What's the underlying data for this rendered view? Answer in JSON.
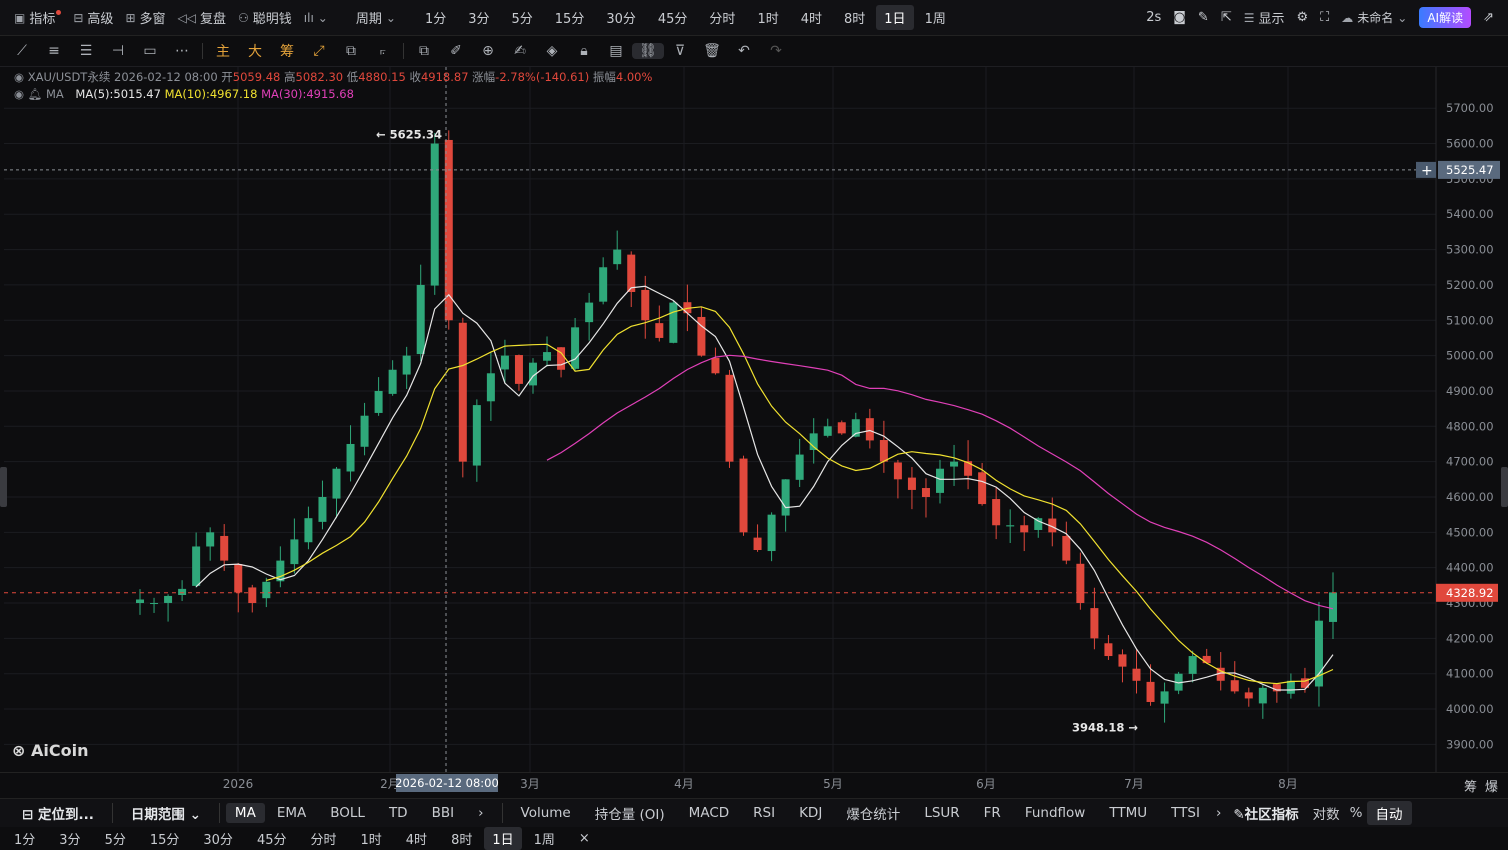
{
  "topbar": {
    "indicator": "指标",
    "advanced": "高级",
    "multiwindow": "多窗",
    "replay": "复盘",
    "smart_money": "聪明钱",
    "period_label": "周期",
    "periods": [
      "1分",
      "3分",
      "5分",
      "15分",
      "30分",
      "45分",
      "分时",
      "1时",
      "4时",
      "8时",
      "1日",
      "1周"
    ],
    "active_period": "1日",
    "refresh": "2s",
    "display": "显示",
    "layout_name": "未命名",
    "ai": "AI解读"
  },
  "legend": {
    "symbol": "XAU/USDT永续",
    "datetime": "2026-02-12 08:00",
    "open_label": "开",
    "open": "5059.48",
    "high_label": "高",
    "high": "5082.30",
    "low_label": "低",
    "low": "4880.15",
    "close_label": "收",
    "close": "4918.87",
    "change_label": "涨幅",
    "change": "-2.78%(-140.61)",
    "amp_label": "振幅",
    "amp": "4.00%",
    "ma_label": "MA",
    "ma5": "MA(5):5015.47",
    "ma10": "MA(10):4967.18",
    "ma30": "MA(30):4915.68"
  },
  "chart_data": {
    "type": "candlestick",
    "symbol": "XAU/USDT永续",
    "interval": "1日",
    "ylim": [
      3870,
      5760
    ],
    "yticks": [
      5700,
      5600,
      5500,
      5400,
      5300,
      5200,
      5100,
      5000,
      4900,
      4800,
      4700,
      4600,
      4500,
      4400,
      4300,
      4200,
      4100,
      4000,
      3900
    ],
    "y_tick_labels": [
      "5700.00",
      "5600.00",
      "5500.00",
      "5400.00",
      "5300.00",
      "5200.00",
      "5100.00",
      "5000.00",
      "4900.00",
      "4800.00",
      "4700.00",
      "4600.00",
      "4500.00",
      "4400.00",
      "4300.00",
      "4200.00",
      "4100.00",
      "4000.00",
      "3900.00"
    ],
    "x_labels": [
      "2026",
      "2月",
      "3月",
      "4月",
      "5月",
      "6月",
      "7月",
      "8月"
    ],
    "crosshair_price": "5525.47",
    "crosshair_date": "2026-02-12 08:00",
    "last_price": "4328.92",
    "max_label": "5625.34",
    "min_label": "3948.18",
    "ma_series": [
      {
        "name": "MA(5)",
        "color": "#e6e6e6"
      },
      {
        "name": "MA(10)",
        "color": "#f0e130"
      },
      {
        "name": "MA(30)",
        "color": "#e040b8"
      }
    ],
    "close_path": [
      4310,
      4300,
      4320,
      4340,
      4460,
      4500,
      4420,
      4330,
      4300,
      4360,
      4420,
      4480,
      4540,
      4600,
      4680,
      4750,
      4830,
      4900,
      4960,
      5000,
      5200,
      5600,
      5100,
      4700,
      4860,
      4950,
      5000,
      4920,
      4980,
      5010,
      4960,
      5080,
      5150,
      5250,
      5300,
      5180,
      5100,
      5050,
      5150,
      5120,
      5000,
      4950,
      4700,
      4500,
      4450,
      4550,
      4650,
      4720,
      4780,
      4800,
      4780,
      4820,
      4760,
      4700,
      4650,
      4620,
      4600,
      4680,
      4700,
      4660,
      4580,
      4520,
      4520,
      4500,
      4540,
      4500,
      4420,
      4300,
      4200,
      4150,
      4120,
      4080,
      4020,
      4050,
      4100,
      4150,
      4130,
      4080,
      4050,
      4030,
      4060,
      4050,
      4080,
      4060,
      4250,
      4330
    ]
  },
  "bottombar": {
    "locate": "定位到...",
    "range": "日期范围",
    "main_indicators": [
      "MA",
      "EMA",
      "BOLL",
      "TD",
      "BBI"
    ],
    "active_main": "MA",
    "sub_indicators": [
      "Volume",
      "持仓量 (OI)",
      "MACD",
      "RSI",
      "KDJ",
      "爆仓统计",
      "LSUR",
      "FR",
      "Fundflow",
      "TTMU",
      "TTSI"
    ],
    "community": "社区指标",
    "log": "对数",
    "percent": "%",
    "auto": "自动"
  },
  "bottombar2": {
    "periods": [
      "1分",
      "3分",
      "5分",
      "15分",
      "30分",
      "45分",
      "分时",
      "1时",
      "4时",
      "8时",
      "1日",
      "1周"
    ],
    "active": "1日"
  },
  "watermark": "AiCoin",
  "axis_corner": [
    "筹",
    "爆"
  ]
}
